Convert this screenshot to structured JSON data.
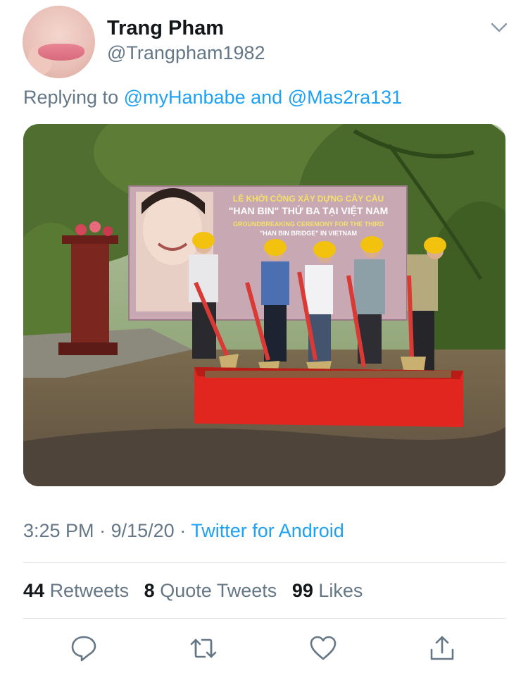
{
  "tweet": {
    "author_name": "Trang Pham",
    "author_handle": "@Trangpham1982",
    "replying_prefix": "Replying to",
    "mention_1": "@myHanbabe",
    "replying_and": "and",
    "mention_2": "@Mas2ra131",
    "time": "3:25 PM",
    "separator": "·",
    "date": "9/15/20",
    "source": "Twitter for Android"
  },
  "photo_text": {
    "banner_line1": "LỄ KHỞI CÔNG XÂY DỰNG CÂY CẦU",
    "banner_line2": "\"HAN BIN\" THỨ BA TẠI VIỆT NAM",
    "banner_line3": "GROUNDBREAKING CEREMONY FOR THE THIRD",
    "banner_line4": "\"HAN BIN BRIDGE\" IN VIETNAM"
  },
  "stats": {
    "retweets_count": "44",
    "retweets_label": "Retweets",
    "quotes_count": "8",
    "quotes_label": "Quote Tweets",
    "likes_count": "99",
    "likes_label": "Likes"
  },
  "icons": {
    "avatar": "avatar",
    "menu": "chevron-down-icon",
    "reply": "reply-icon",
    "retweet": "retweet-icon",
    "like": "like-icon",
    "share": "share-icon"
  },
  "colors": {
    "accent": "#1da1f2",
    "secondary_text": "#657786",
    "primary_text": "#14171a",
    "divider": "#dfe3e7"
  }
}
